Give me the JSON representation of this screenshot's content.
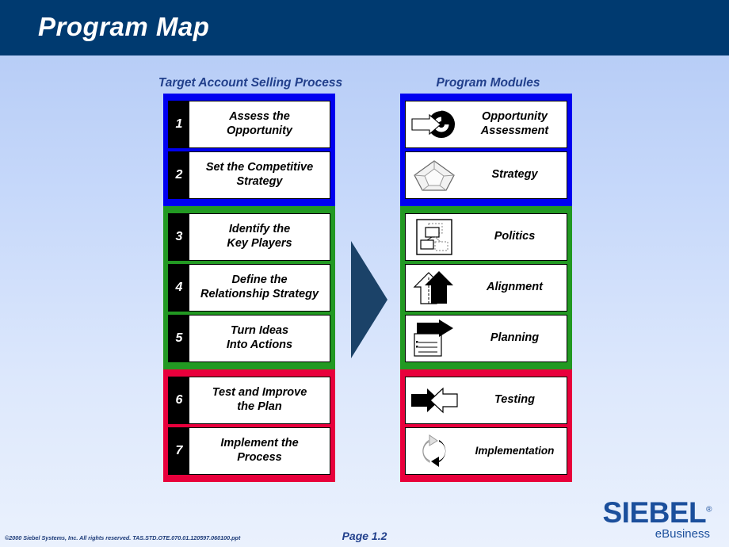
{
  "slide": {
    "title": "Program Map",
    "header_bg": "#003a70",
    "accent_blue": "#0000f0",
    "accent_green": "#229922",
    "accent_red": "#e8003c",
    "arrow_color": "#1b4268"
  },
  "columns": {
    "left_heading": "Target Account Selling Process",
    "right_heading": "Program Modules"
  },
  "process": {
    "groups": [
      {
        "color_name": "blue",
        "steps": [
          {
            "number": "1",
            "label": "Assess the\nOpportunity"
          },
          {
            "number": "2",
            "label": "Set the Competitive\nStrategy"
          }
        ]
      },
      {
        "color_name": "green",
        "steps": [
          {
            "number": "3",
            "label": "Identify the\nKey Players"
          },
          {
            "number": "4",
            "label": "Define the\nRelationship Strategy"
          },
          {
            "number": "5",
            "label": "Turn Ideas\nInto Actions"
          }
        ]
      },
      {
        "color_name": "red",
        "steps": [
          {
            "number": "6",
            "label": "Test and Improve\nthe Plan"
          },
          {
            "number": "7",
            "label": "Implement the\nProcess"
          }
        ]
      }
    ]
  },
  "modules": {
    "groups": [
      {
        "color_name": "blue",
        "items": [
          {
            "label": "Opportunity\nAssessment",
            "icon": "target-arrow-icon"
          },
          {
            "label": "Strategy",
            "icon": "pentagon-icon"
          }
        ]
      },
      {
        "color_name": "green",
        "items": [
          {
            "label": "Politics",
            "icon": "org-boxes-icon"
          },
          {
            "label": "Alignment",
            "icon": "up-arrows-icon"
          },
          {
            "label": "Planning",
            "icon": "arrow-document-icon"
          }
        ]
      },
      {
        "color_name": "red",
        "items": [
          {
            "label": "Testing",
            "icon": "opposing-arrows-icon"
          },
          {
            "label": "Implementation",
            "icon": "circular-arrows-icon"
          }
        ]
      }
    ]
  },
  "footer": {
    "copyright": "©2000 Siebel Systems, Inc. All rights reserved.   TAS.STD.OTE.070.01.120597.060100.ppt",
    "page": "Page 1.2",
    "logo_wordmark": "SIEBEL",
    "logo_reg": "®",
    "logo_tagline": "eBusiness",
    "logo_color": "#1b4f9c"
  }
}
